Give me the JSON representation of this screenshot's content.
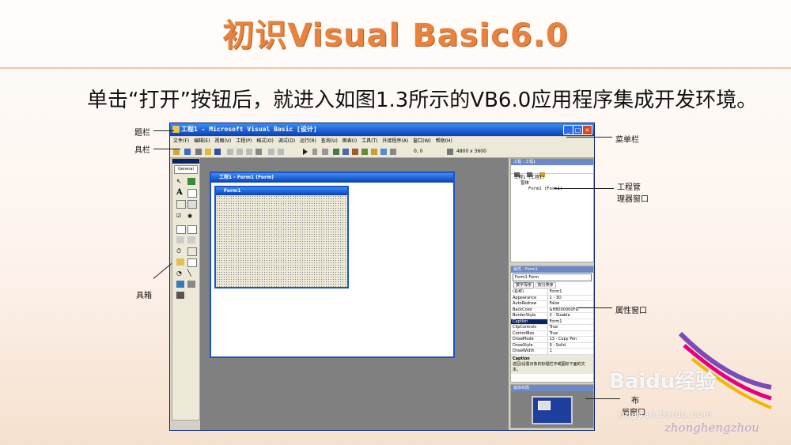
{
  "slide": {
    "title": "初识Visual Basic6.0",
    "intro": "单击“打开”按钮后，就进入如图1.3所示的VB6.0应用程序集成开发环境。"
  },
  "callouts": {
    "title_bar": "题栏",
    "toolbar": "具栏",
    "toolbox": "具箱",
    "menu_bar": "菜单栏",
    "project_explorer_1": "工程管",
    "project_explorer_2": "理器窗口",
    "properties": "属性窗口",
    "form_layout_1": "布",
    "form_layout_2": "局窗口"
  },
  "vb": {
    "window_title": "工程1 - Microsoft Visual Basic [设计]",
    "menu": [
      "文件(F)",
      "编辑(E)",
      "视图(V)",
      "工程(P)",
      "格式(O)",
      "调试(D)",
      "运行(R)",
      "查询(U)",
      "图表(I)",
      "工具(T)",
      "外接程序(A)",
      "窗口(W)",
      "帮助(H)"
    ],
    "toolbar_coords": "0, 0",
    "toolbar_size": "4800 x 3600",
    "toolbox_tab": "General",
    "form_window_title": "工程1 - Form1 (Form)",
    "form_caption": "Form1",
    "project_panel_title": "工程 - 工程1",
    "project_tree": [
      "工程1 (工程1)",
      "窗体",
      "Form1 (Form1)"
    ],
    "props_panel_title": "属性 - Form1",
    "props_object": "Form1 Form",
    "props_tabs": [
      "按字母序",
      "按分类序"
    ],
    "props": [
      {
        "k": "(名称)",
        "v": "Form1"
      },
      {
        "k": "Appearance",
        "v": "1 - 3D"
      },
      {
        "k": "AutoRedraw",
        "v": "False"
      },
      {
        "k": "BackColor",
        "v": "&H8000000F&"
      },
      {
        "k": "BorderStyle",
        "v": "2 - Sizable"
      },
      {
        "k": "Caption",
        "v": "Form1"
      },
      {
        "k": "ClipControls",
        "v": "True"
      },
      {
        "k": "ControlBox",
        "v": "True"
      },
      {
        "k": "DrawMode",
        "v": "13 - Copy Pen"
      },
      {
        "k": "DrawStyle",
        "v": "0 - Solid"
      },
      {
        "k": "DrawWidth",
        "v": "1"
      }
    ],
    "props_desc_title": "Caption",
    "props_desc": "返回/设置对象的标题栏中或图标下面的文本。",
    "layout_panel_title": "窗体布局"
  },
  "watermark": {
    "brand": "Baidu经验",
    "url": "jingyan.baidu.com",
    "sig": "zhonghengzhou"
  }
}
